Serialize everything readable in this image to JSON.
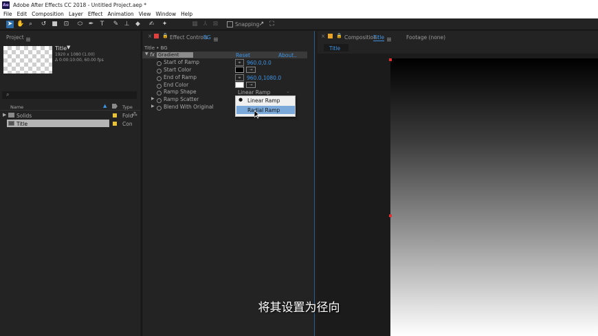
{
  "app": {
    "logo_text": "Ae",
    "window_title": "Adobe After Effects CC 2018 - Untitled Project.aep *"
  },
  "menu": [
    "File",
    "Edit",
    "Composition",
    "Layer",
    "Effect",
    "Animation",
    "View",
    "Window",
    "Help"
  ],
  "toolbar": {
    "snapping_label": "Snapping"
  },
  "project": {
    "tab_label": "Project",
    "comp_name": "Title",
    "comp_info_1": "1920 x 1080 (1.00)",
    "comp_info_2": "Δ 0:00:10:00, 60.00 fps",
    "col_name": "Name",
    "col_type": "Type",
    "items": [
      {
        "name": "Solids",
        "type": "Fold"
      },
      {
        "name": "Title",
        "type": "Con"
      }
    ]
  },
  "effect_controls": {
    "tab_label": "Effect Controls",
    "tab_layer": "BG",
    "breadcrumb": "Title • BG",
    "effect_name": "Gradient Ramp",
    "reset_label": "Reset",
    "about_label": "About..",
    "properties": [
      {
        "name": "Start of Ramp",
        "value": "960.0,0.0"
      },
      {
        "name": "Start Color",
        "value": ""
      },
      {
        "name": "End of Ramp",
        "value": "960.0,1080.0"
      },
      {
        "name": "End Color",
        "value": ""
      },
      {
        "name": "Ramp Shape",
        "value": "Linear Ramp"
      },
      {
        "name": "Ramp Scatter",
        "value": ""
      },
      {
        "name": "Blend With Original",
        "value": ""
      }
    ],
    "dropdown_options": [
      "Linear Ramp",
      "Radial Ramp"
    ],
    "dropdown_selected": "Linear Ramp",
    "dropdown_hovered": "Radial Ramp"
  },
  "composition": {
    "tab_prefix": "Composition",
    "tab_name": "Title",
    "footage_tab": "Footage (none)",
    "viewer_tab": "Title"
  },
  "subtitle": "将其设置为径向",
  "colors": {
    "accent_blue": "#3e95e6",
    "label_yellow": "#e8c23a",
    "highlight": "#7aa9da"
  }
}
